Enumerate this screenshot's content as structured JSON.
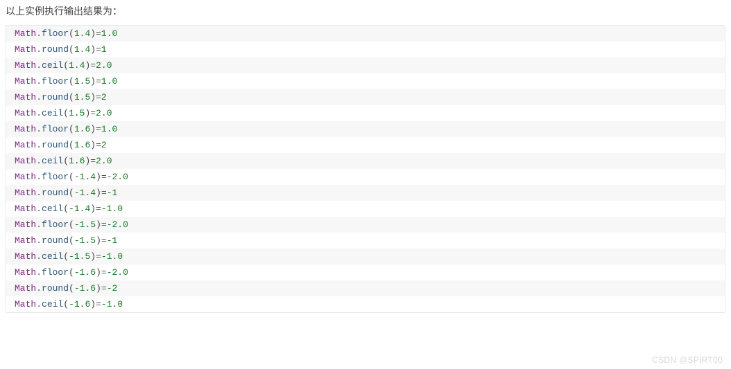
{
  "intro": "以上实例执行输出结果为：",
  "obj": "Math",
  "lines": [
    {
      "func": "floor",
      "arg": "1.4",
      "result": "1.0"
    },
    {
      "func": "round",
      "arg": "1.4",
      "result": "1"
    },
    {
      "func": "ceil",
      "arg": "1.4",
      "result": "2.0"
    },
    {
      "func": "floor",
      "arg": "1.5",
      "result": "1.0"
    },
    {
      "func": "round",
      "arg": "1.5",
      "result": "2"
    },
    {
      "func": "ceil",
      "arg": "1.5",
      "result": "2.0"
    },
    {
      "func": "floor",
      "arg": "1.6",
      "result": "1.0"
    },
    {
      "func": "round",
      "arg": "1.6",
      "result": "2"
    },
    {
      "func": "ceil",
      "arg": "1.6",
      "result": "2.0"
    },
    {
      "func": "floor",
      "arg": "-1.4",
      "result": "-2.0"
    },
    {
      "func": "round",
      "arg": "-1.4",
      "result": "-1"
    },
    {
      "func": "ceil",
      "arg": "-1.4",
      "result": "-1.0"
    },
    {
      "func": "floor",
      "arg": "-1.5",
      "result": "-2.0"
    },
    {
      "func": "round",
      "arg": "-1.5",
      "result": "-1"
    },
    {
      "func": "ceil",
      "arg": "-1.5",
      "result": "-1.0"
    },
    {
      "func": "floor",
      "arg": "-1.6",
      "result": "-2.0"
    },
    {
      "func": "round",
      "arg": "-1.6",
      "result": "-2"
    },
    {
      "func": "ceil",
      "arg": "-1.6",
      "result": "-1.0"
    }
  ],
  "watermark": "CSDN @SPIRT00"
}
